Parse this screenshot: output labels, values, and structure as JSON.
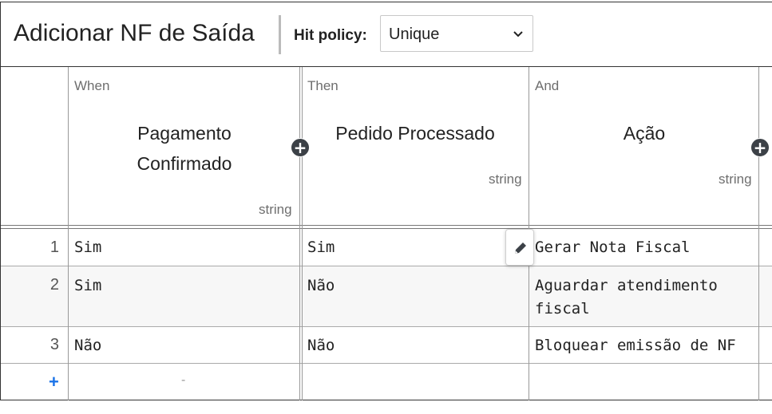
{
  "header": {
    "title": "Adicionar NF de Saída",
    "hit_policy_label": "Hit policy:",
    "hit_policy_value": "Unique"
  },
  "columns": [
    {
      "kind": "When",
      "name_line1": "Pagamento",
      "name_line2": "Confirmado",
      "type": "string"
    },
    {
      "kind": "Then",
      "name_line1": "Pedido Processado",
      "name_line2": "",
      "type": "string"
    },
    {
      "kind": "And",
      "name_line1": "Ação",
      "name_line2": "",
      "type": "string"
    }
  ],
  "rows": [
    {
      "num": "1",
      "c1": "Sim",
      "c2": "Sim",
      "c3_line1": "Gerar Nota Fiscal",
      "c3_line2": ""
    },
    {
      "num": "2",
      "c1": "Sim",
      "c2": "Não",
      "c3_line1": "Aguardar atendimento",
      "c3_line2": "fiscal"
    },
    {
      "num": "3",
      "c1": "Não",
      "c2": "Não",
      "c3_line1": "Bloquear emissão de NF",
      "c3_line2": ""
    }
  ],
  "add_row": {
    "label": "+",
    "placeholder": "-"
  },
  "icons": {
    "add_column": "plus-circle-icon",
    "edit": "pencil-icon",
    "dropdown": "chevron-down-icon"
  },
  "colors": {
    "add_row": "#1a73e8",
    "plus_button": "#3c4147",
    "striped_row": "#f7f7f7"
  }
}
